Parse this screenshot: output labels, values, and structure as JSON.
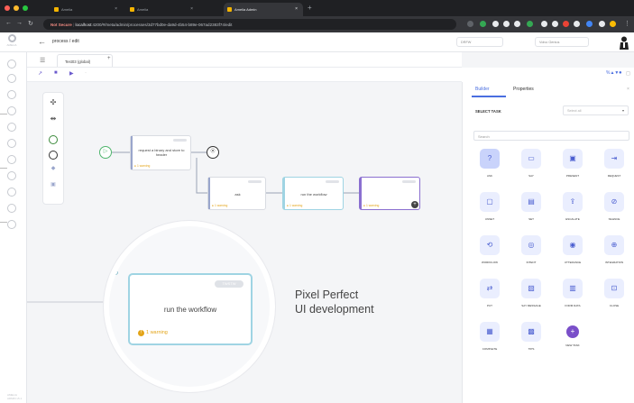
{
  "browser": {
    "tabs": [
      {
        "label": "Amelia"
      },
      {
        "label": "Amelia"
      },
      {
        "label": "Amelia Admin"
      }
    ],
    "new_tab": "+",
    "url_security": "Not Secure",
    "url_host": "localhost",
    "url_path": ":4200/#/meta/admin/processes/3d77bd0e-da9d-4b54-b89e-067ad2383f74/edit"
  },
  "app": {
    "logo_text": "AMELIA",
    "breadcrumb": "process / edit",
    "header_boxes": [
      "DRFW",
      "Volvo Genius"
    ],
    "rail_text": "AMELIA ADMIN v5.1"
  },
  "toolbar": {
    "workflow_tab": "Test03 (global)",
    "add": "+"
  },
  "nodes": {
    "request": {
      "label": "request a binary and store to header",
      "warning": "1 warning"
    },
    "ask": {
      "label": "ask",
      "warning": "1 warning"
    },
    "run": {
      "label": "run the workflow",
      "warning": "1 warning"
    },
    "last": {
      "warning": "1 warning"
    }
  },
  "magnified": {
    "label": "run the workflow",
    "badge": "TWSTW",
    "warning": "1 warning"
  },
  "headline": {
    "line1": "Pixel Perfect",
    "line2": "UI development"
  },
  "panel": {
    "tab_builder": "Builder",
    "tab_properties": "Properties",
    "select_label": "SELECT TASK",
    "select_value": "Select all",
    "search_placeholder": "Search",
    "tasks": [
      {
        "label": "ASK",
        "icon": "?"
      },
      {
        "label": "SAY",
        "icon": "▭"
      },
      {
        "label": "PRESENT",
        "icon": "▣"
      },
      {
        "label": "REQUEST",
        "icon": "⇥"
      },
      {
        "label": "UNSET",
        "icon": "▢"
      },
      {
        "label": "SET",
        "icon": "▤"
      },
      {
        "label": "ESCALATE",
        "icon": "⇪"
      },
      {
        "label": "SILENCE",
        "icon": "⊘"
      },
      {
        "label": "WORKFLOW",
        "icon": "⟲"
      },
      {
        "label": "INTENT",
        "icon": "◎"
      },
      {
        "label": "UTTERANCE",
        "icon": "◉"
      },
      {
        "label": "INTEGRATION",
        "icon": "⊕"
      },
      {
        "label": "PUT",
        "icon": "⇄"
      },
      {
        "label": "SAY MESSAGE",
        "icon": "▧"
      },
      {
        "label": "FORM DATA",
        "icon": "▥"
      },
      {
        "label": "CLOSE",
        "icon": "⊡"
      },
      {
        "label": "COMPLETE",
        "icon": "▦"
      },
      {
        "label": "TIPS",
        "icon": "▩"
      },
      {
        "label": "NEW TASK",
        "icon": "+"
      }
    ]
  },
  "colors": {
    "accent": "#4a6ee0",
    "warning": "#e3a418",
    "start": "#4fb56d",
    "node_highlight": "#9fd4e3"
  }
}
